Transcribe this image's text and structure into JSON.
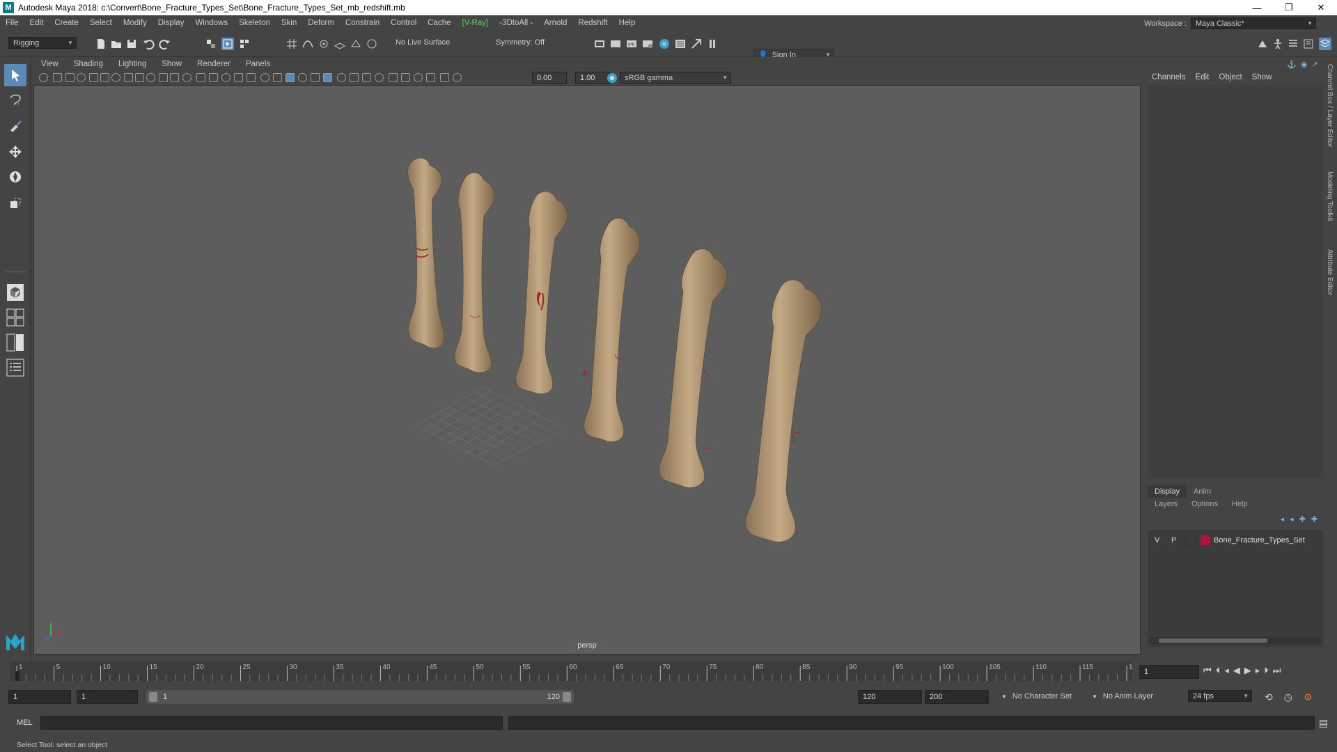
{
  "title_bar": {
    "title": "Autodesk Maya 2018: c:\\Convert\\Bone_Fracture_Types_Set\\Bone_Fracture_Types_Set_mb_redshift.mb",
    "minimize": "—",
    "restore": "❐",
    "close": "✕"
  },
  "menubar": {
    "items": [
      "File",
      "Edit",
      "Create",
      "Select",
      "Modify",
      "Display",
      "Windows",
      "Skeleton",
      "Skin",
      "Deform",
      "Constrain",
      "Control",
      "Cache",
      "[V-Ray]",
      "-3DtoAll -",
      "Arnold",
      "Redshift",
      "Help"
    ],
    "workspace_label": "Workspace :",
    "workspace_value": "Maya Classic*"
  },
  "statusline": {
    "menuset": "Rigging",
    "live_surface": "No Live Surface",
    "symmetry": "Symmetry: Off",
    "sign_in": "Sign In"
  },
  "panel": {
    "menu": [
      "View",
      "Shading",
      "Lighting",
      "Show",
      "Renderer",
      "Panels"
    ],
    "exposure": "0.00",
    "gamma": "1.00",
    "color_space": "sRGB gamma",
    "camera": "persp"
  },
  "channel_box": {
    "menu": [
      "Channels",
      "Edit",
      "Object",
      "Show"
    ],
    "side_tabs": [
      "Channel Box / Layer Editor",
      "Modeling Toolkit",
      "Attribute Editor"
    ]
  },
  "layer_editor": {
    "tabs": [
      "Display",
      "Anim"
    ],
    "menu": [
      "Layers",
      "Options",
      "Help"
    ],
    "layers": [
      {
        "v": "V",
        "p": "P",
        "name": "Bone_Fracture_Types_Set",
        "color": "#b3113a"
      }
    ]
  },
  "timeline": {
    "ticks": [
      "1",
      "5",
      "10",
      "15",
      "20",
      "25",
      "30",
      "35",
      "40",
      "45",
      "50",
      "55",
      "60",
      "65",
      "70",
      "75",
      "80",
      "85",
      "90",
      "95",
      "100",
      "105",
      "110",
      "115",
      "120"
    ],
    "current_frame": "1"
  },
  "range": {
    "start_time": "1",
    "playback_start": "1",
    "range_start": "1",
    "range_end": "120",
    "playback_end": "120",
    "end_time": "200",
    "character_set": "No Character Set",
    "anim_layer": "No Anim Layer",
    "fps": "24 fps"
  },
  "command_line": {
    "label": "MEL"
  },
  "help_line": {
    "text": "Select Tool: select an object"
  },
  "colors": {
    "accent": "#5a8ab5",
    "viewport_bg": "#5d5d5d",
    "bone": "#b49a78",
    "fracture": "#a0281a"
  }
}
